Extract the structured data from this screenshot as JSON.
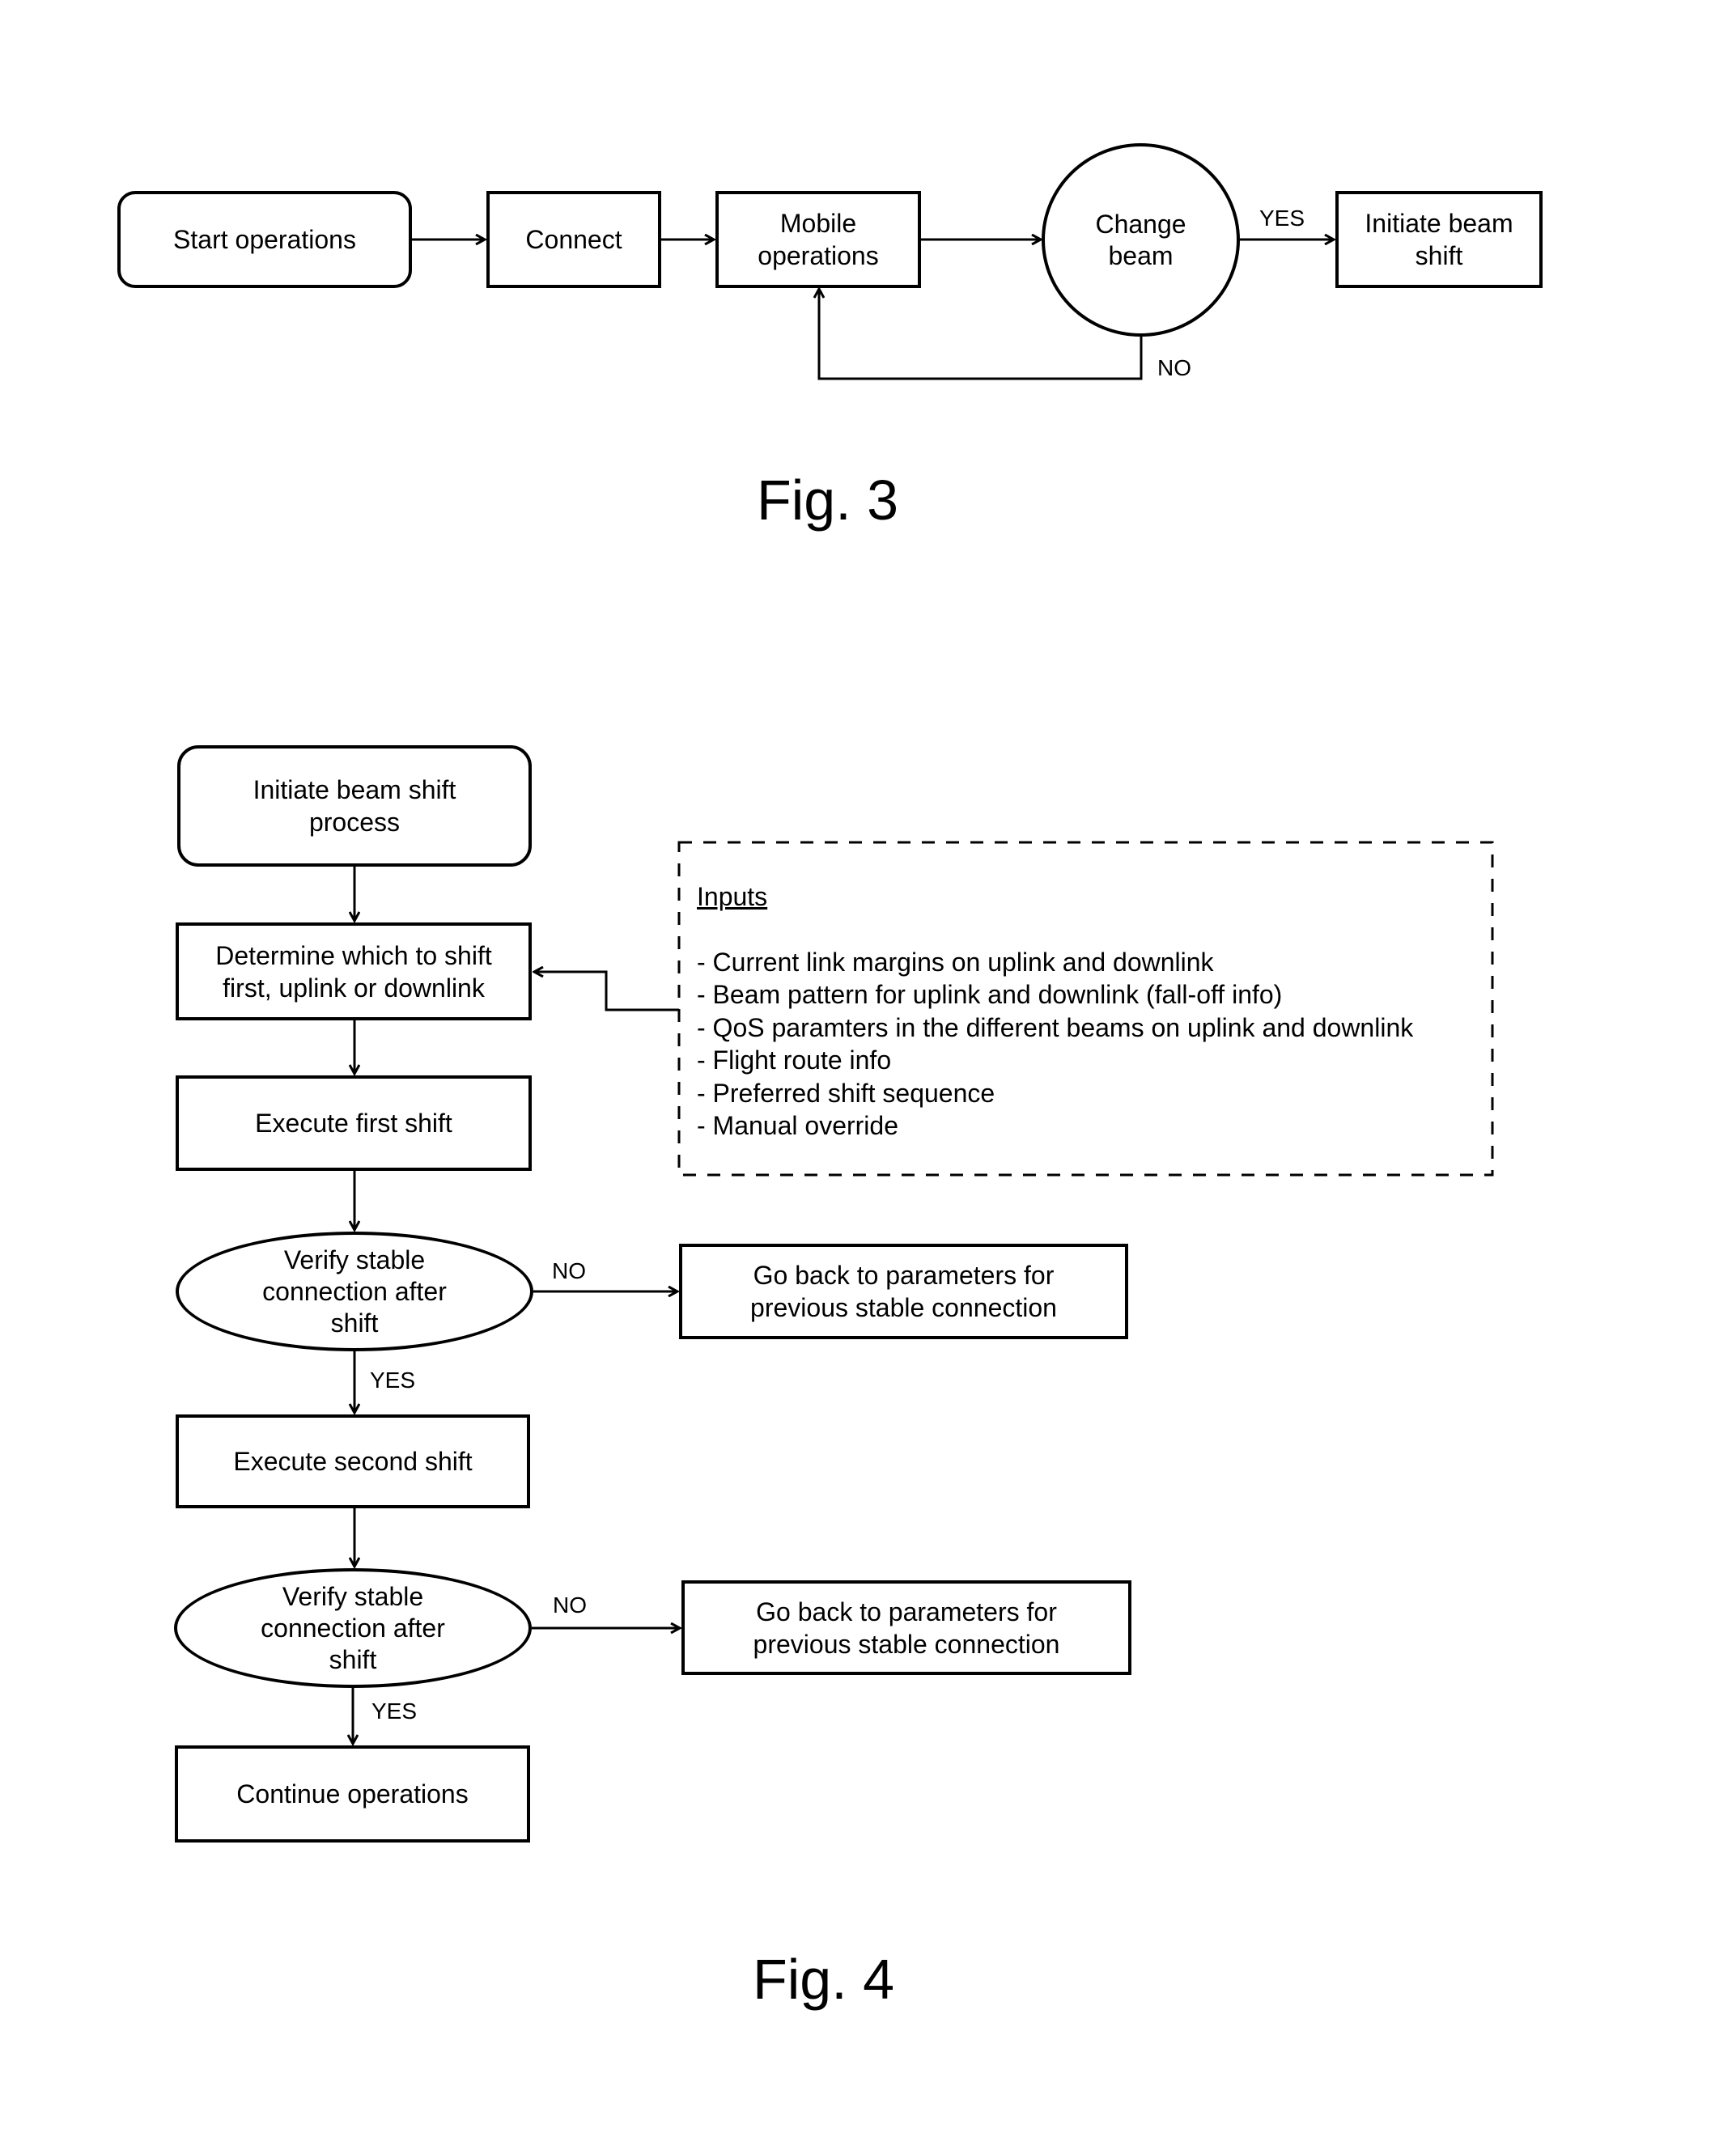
{
  "fig3": {
    "caption": "Fig. 3",
    "nodes": {
      "start": "Start operations",
      "connect": "Connect",
      "mobile": "Mobile\noperations",
      "change_beam": "Change\nbeam",
      "initiate": "Initiate beam\nshift"
    },
    "labels": {
      "yes": "YES",
      "no": "NO"
    }
  },
  "fig4": {
    "caption": "Fig. 4",
    "nodes": {
      "initiate_process": "Initiate beam shift\nprocess",
      "determine": "Determine which to shift\nfirst, uplink or downlink",
      "execute_first": "Execute first shift",
      "verify1": "Verify stable\nconnection after\nshift",
      "goback1": "Go back to parameters  for\nprevious stable connection",
      "execute_second": "Execute second shift",
      "verify2": "Verify stable\nconnection after\nshift",
      "goback2": "Go back to parameters  for\nprevious stable connection",
      "continue": "Continue operations"
    },
    "labels": {
      "no1": "NO",
      "yes1": "YES",
      "no2": "NO",
      "yes2": "YES"
    },
    "inputs": {
      "title": "Inputs",
      "items": [
        "- Current link margins  on uplink and downlink",
        "- Beam pattern  for uplink and downlink (fall-off info)",
        "- QoS paramters  in the different beams on uplink and downlink",
        "- Flight route info",
        "- Preferred shift sequence",
        "- Manual  override"
      ]
    }
  }
}
